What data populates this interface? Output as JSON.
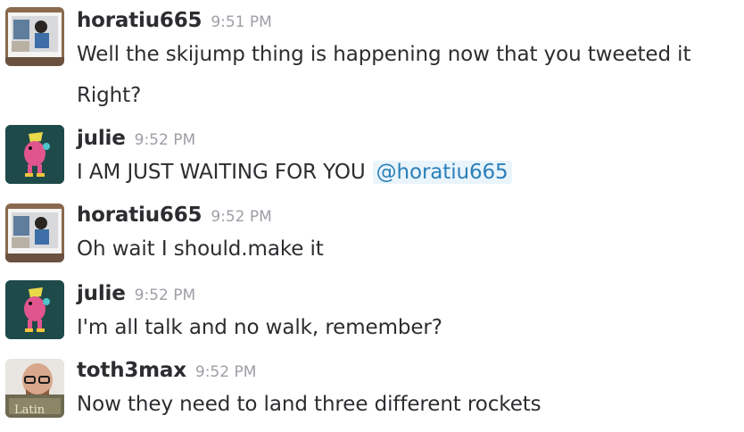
{
  "messages": [
    {
      "author": "horatiu665",
      "time": "9:51 PM",
      "avatar": "photo-avatar-icon",
      "lines": [
        "Well the skijump thing is happening now that you tweeted it",
        "Right?"
      ]
    },
    {
      "author": "julie",
      "time": "9:52 PM",
      "avatar": "cartoon-creature-avatar-icon",
      "text": "I AM JUST WAITING FOR YOU",
      "mention": "@horatiu665"
    },
    {
      "author": "horatiu665",
      "time": "9:52 PM",
      "avatar": "photo-avatar-icon",
      "text": "Oh wait I should.make it"
    },
    {
      "author": "julie",
      "time": "9:52 PM",
      "avatar": "cartoon-creature-avatar-icon",
      "text": "I'm all talk and no walk, remember?"
    },
    {
      "author": "toth3max",
      "time": "9:52 PM",
      "avatar": "person-with-book-avatar-icon",
      "avatar_text": "Latin",
      "text": "Now they need to land three different rockets"
    }
  ],
  "colors": {
    "text": "#2c2d30",
    "timestamp": "#9e9ea6",
    "mention_text": "#2a80b9",
    "mention_bg": "#eaf4fb",
    "julie_avatar_bg": "#1f4a4a"
  }
}
